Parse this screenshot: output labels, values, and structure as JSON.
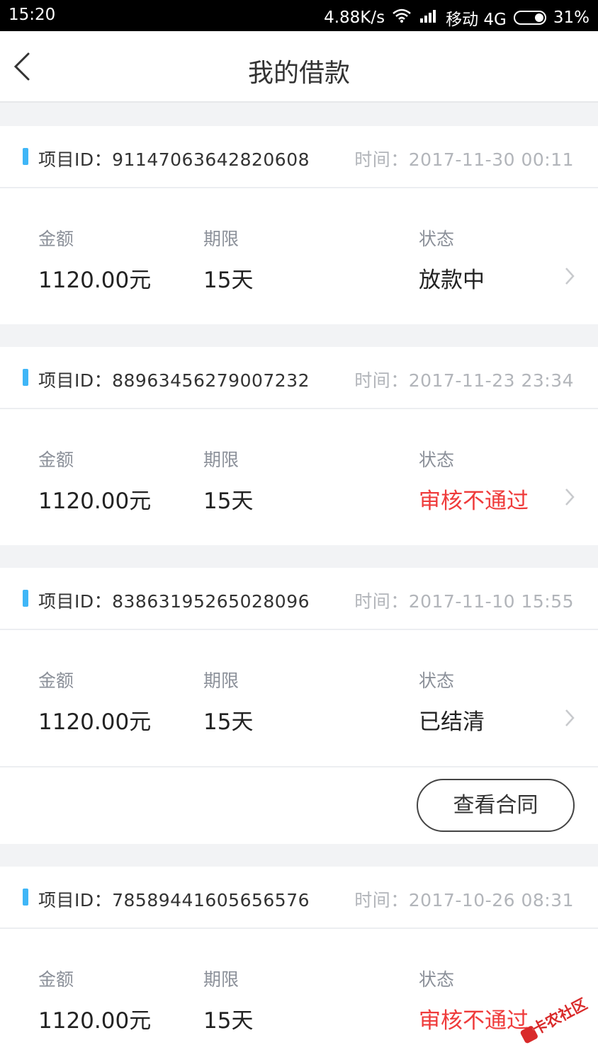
{
  "status_bar": {
    "time": "15:20",
    "speed": "4.88K/s",
    "carrier": "移动 4G",
    "battery": "31%",
    "battery_level": 0.31
  },
  "header": {
    "title": "我的借款"
  },
  "labels": {
    "amount": "金额",
    "term": "期限",
    "status": "状态"
  },
  "loans": [
    {
      "id": "项目ID：91147063642820608",
      "time": "时间：2017-11-30 00:11",
      "amount": "1120.00元",
      "term": "15天",
      "status": "放款中"
    },
    {
      "id": "项目ID：88963456279007232",
      "time": "时间：2017-11-23 23:34",
      "amount": "1120.00元",
      "term": "15天",
      "status": "审核不通过"
    },
    {
      "id": "项目ID：83863195265028096",
      "time": "时间：2017-11-10 15:55",
      "amount": "1120.00元",
      "term": "15天",
      "status": "已结清",
      "action": "查看合同"
    },
    {
      "id": "项目ID：78589441605656576",
      "time": "时间：2017-10-26 08:31",
      "amount": "1120.00元",
      "term": "15天",
      "status": "审核不通过"
    }
  ],
  "watermark": "卡农社区",
  "colors": {
    "accent_blue": "#3fb6f7",
    "status_red": "#ef3b3b"
  }
}
